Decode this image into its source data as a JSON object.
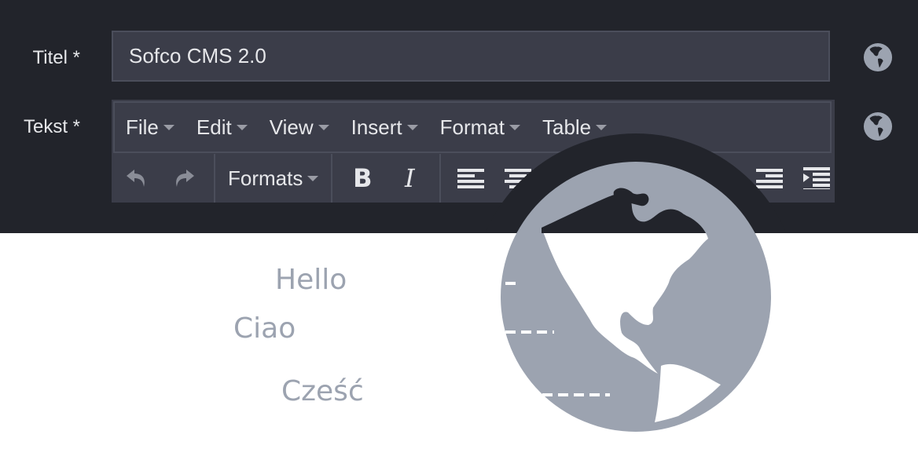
{
  "form": {
    "title_label": "Titel *",
    "title_value": "Sofco CMS 2.0",
    "text_label": "Tekst *"
  },
  "editor": {
    "menus": [
      "File",
      "Edit",
      "View",
      "Insert",
      "Format",
      "Table"
    ],
    "toolbar": {
      "undo": "undo-icon",
      "redo": "redo-icon",
      "formats_label": "Formats",
      "bold": "B",
      "italic": "I",
      "align_left": "align-left-icon",
      "align_center": "align-center-icon",
      "align_right": "align-right-icon",
      "indent": "indent-icon"
    }
  },
  "translations": {
    "greetings": [
      "Hello",
      "Ciao",
      "Cześć"
    ]
  },
  "colors": {
    "header_bg": "#22242b",
    "input_bg": "#3b3d49",
    "globe": "#9ca3b0"
  }
}
